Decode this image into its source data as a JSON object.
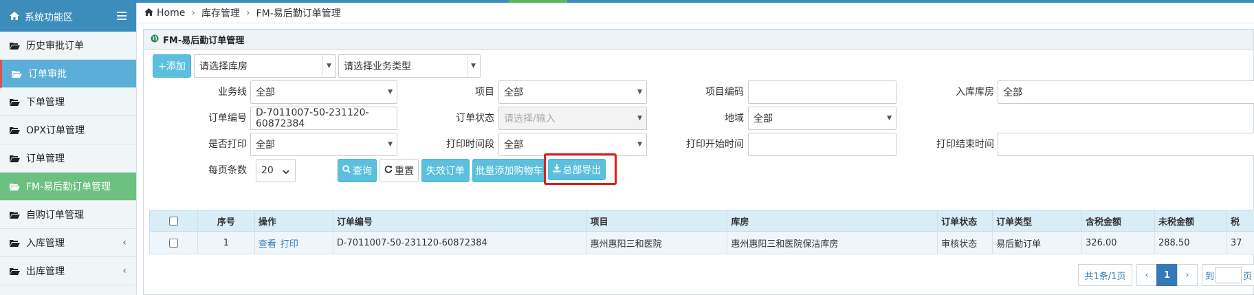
{
  "sidebar": {
    "header": "系统功能区",
    "items": [
      {
        "label": "历史审批订单"
      },
      {
        "label": "订单审批"
      },
      {
        "label": "下单管理"
      },
      {
        "label": "OPX订单管理"
      },
      {
        "label": "订单管理"
      },
      {
        "label": "FM-易后勤订单管理"
      },
      {
        "label": "自购订单管理"
      },
      {
        "label": "入库管理",
        "chevron": "‹"
      },
      {
        "label": "出库管理",
        "chevron": "‹"
      }
    ]
  },
  "breadcrumb": {
    "home": "Home",
    "sep": "›",
    "level1": "库存管理",
    "level2": "FM-易后勤订单管理"
  },
  "panel": {
    "title": "FM-易后勤订单管理"
  },
  "toolbar": {
    "add_label": "+添加",
    "warehouse_select": "请选择库房",
    "biztype_select": "请选择业务类型"
  },
  "filters": {
    "business_line_label": "业务线",
    "business_line_value": "全部",
    "project_label": "项目",
    "project_value": "全部",
    "project_code_label": "项目编码",
    "project_code_value": "",
    "inbound_warehouse_label": "入库库房",
    "inbound_warehouse_value": "全部",
    "order_no_label": "订单编号",
    "order_no_value": "D-7011007-50-231120-60872384",
    "order_status_label": "订单状态",
    "order_status_placeholder": "请选择/输入",
    "region_label": "地域",
    "region_value": "全部",
    "printed_label": "是否打印",
    "printed_value": "全部",
    "print_period_label": "打印时间段",
    "print_period_value": "全部",
    "print_start_label": "打印开始时间",
    "print_end_label": "打印结束时间",
    "page_size_label": "每页条数",
    "page_size_value": "20"
  },
  "actions": {
    "query": "查询",
    "reset": "重置",
    "invalid": "失效订单",
    "batch_add_cart": "批量添加购物车",
    "export_all": "总部导出"
  },
  "table": {
    "headers": [
      "序号",
      "操作",
      "订单编号",
      "项目",
      "库房",
      "订单状态",
      "订单类型",
      "含税金额",
      "未税金额",
      "税"
    ],
    "rows": [
      {
        "no": "1",
        "op_view": "查看",
        "op_print": "打印",
        "order_no": "D-7011007-50-231120-60872384",
        "project": "惠州惠阳三和医院",
        "warehouse": "惠州惠阳三和医院保洁库房",
        "status": "审核状态",
        "type": "易后勤订单",
        "amount_tax": "326.00",
        "amount_notax": "288.50",
        "tax": "37"
      }
    ]
  },
  "pager": {
    "summary": "共1条/1页",
    "prev": "‹",
    "current": "1",
    "next": "›",
    "goto_prefix": "到",
    "goto_suffix": "页"
  },
  "colors": {
    "primary": "#3c8dbc",
    "info": "#5bc0de",
    "active_green": "#6cc080",
    "highlight_red": "#e31a1a"
  }
}
